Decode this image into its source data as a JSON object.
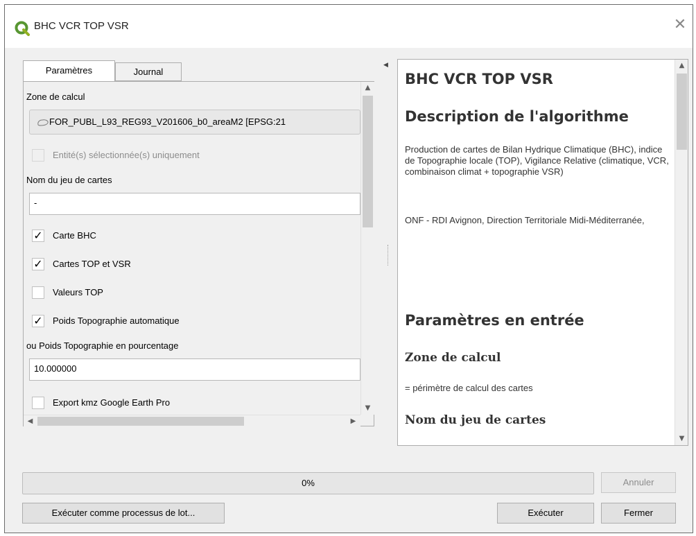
{
  "window": {
    "title": "BHC VCR TOP VSR",
    "icons": {
      "app": "qgis-logo-icon",
      "close": "close-icon"
    },
    "accent_color": "#589632"
  },
  "tabs": [
    {
      "label": "Paramètres",
      "active": true
    },
    {
      "label": "Journal",
      "active": false
    }
  ],
  "params": {
    "zone_label": "Zone de calcul",
    "zone_value": "FOR_PUBL_L93_REG93_V201606_b0_areaM2 [EPSG:21",
    "zone_icon": "polygon-layer-icon",
    "selected_only_label": "Entité(s) sélectionnée(s) uniquement",
    "selected_only_checked": false,
    "map_set_label": "Nom du jeu de cartes",
    "map_set_value": "-",
    "carte_bhc_label": "Carte BHC",
    "carte_bhc_checked": true,
    "cartes_top_vsr_label": "Cartes TOP et VSR",
    "cartes_top_vsr_checked": true,
    "valeurs_top_label": "Valeurs TOP",
    "valeurs_top_checked": false,
    "poids_auto_label": "Poids Topographie automatique",
    "poids_auto_checked": true,
    "poids_pct_label": "ou Poids Topographie en pourcentage",
    "poids_pct_value": "10.000000",
    "export_kmz_label": "Export kmz Google Earth Pro",
    "export_kmz_checked": false,
    "check_glyph": "✓"
  },
  "help": {
    "title": "BHC VCR TOP VSR",
    "desc_heading": "Description de l'algorithme",
    "desc_text": "Production de cartes de Bilan Hydrique Climatique (BHC), indice de Topographie locale (TOP), Vigilance Relative (climatique, VCR, combinaison climat + topographie VSR)",
    "author_text": "ONF - RDI Avignon, Direction Territoriale Midi-Méditerranée,",
    "params_heading": "Paramètres en entrée",
    "zone_heading": "Zone de calcul",
    "zone_desc": "= périmètre de calcul des cartes",
    "map_set_heading": "Nom du jeu de cartes"
  },
  "progress": {
    "label": "0%",
    "value": 0,
    "color": "#06b025"
  },
  "buttons": {
    "cancel": "Annuler",
    "batch": "Exécuter comme processus de lot...",
    "run": "Exécuter",
    "close": "Fermer"
  }
}
